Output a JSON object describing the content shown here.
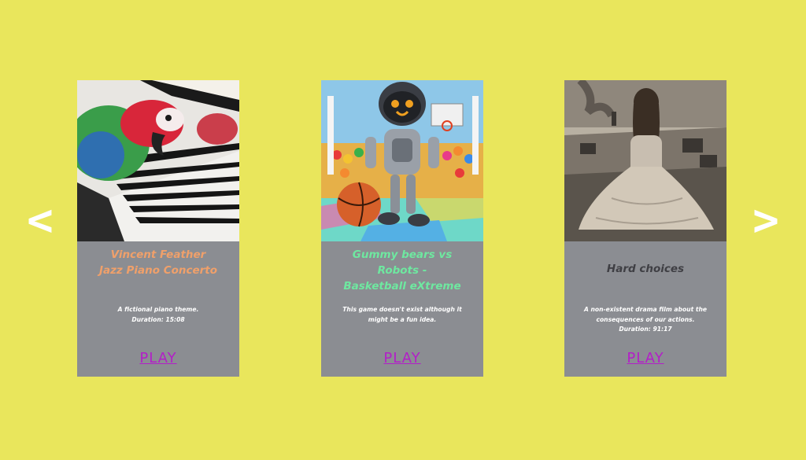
{
  "colors": {
    "background": "#e9e65c",
    "card_background": "#8b8d92",
    "play_link": "#b31ec8",
    "arrow": "#ffffff"
  },
  "carousel": {
    "prev_label": "<",
    "next_label": ">",
    "cards": [
      {
        "image_icon": "parrot-piano-image",
        "title": "Vincent Feather\nJazz Piano Concerto",
        "title_color": "#f0a06a",
        "description": "A fictional piano theme.\nDuration: 15:08",
        "play_label": "PLAY"
      },
      {
        "image_icon": "robot-basketball-image",
        "title": "Gummy bears vs\nRobots -\nBasketball eXtreme",
        "title_color": "#6ee8a0",
        "description": "This game doesn't exist although it\nmight be a fun idea.",
        "play_label": "PLAY"
      },
      {
        "image_icon": "woman-landscape-image",
        "title": "Hard choices",
        "title_color": "#3f3f44",
        "description": "A non-existent drama film about the\nconsequences of our actions.\nDuration: 91:17",
        "play_label": "PLAY"
      }
    ]
  }
}
